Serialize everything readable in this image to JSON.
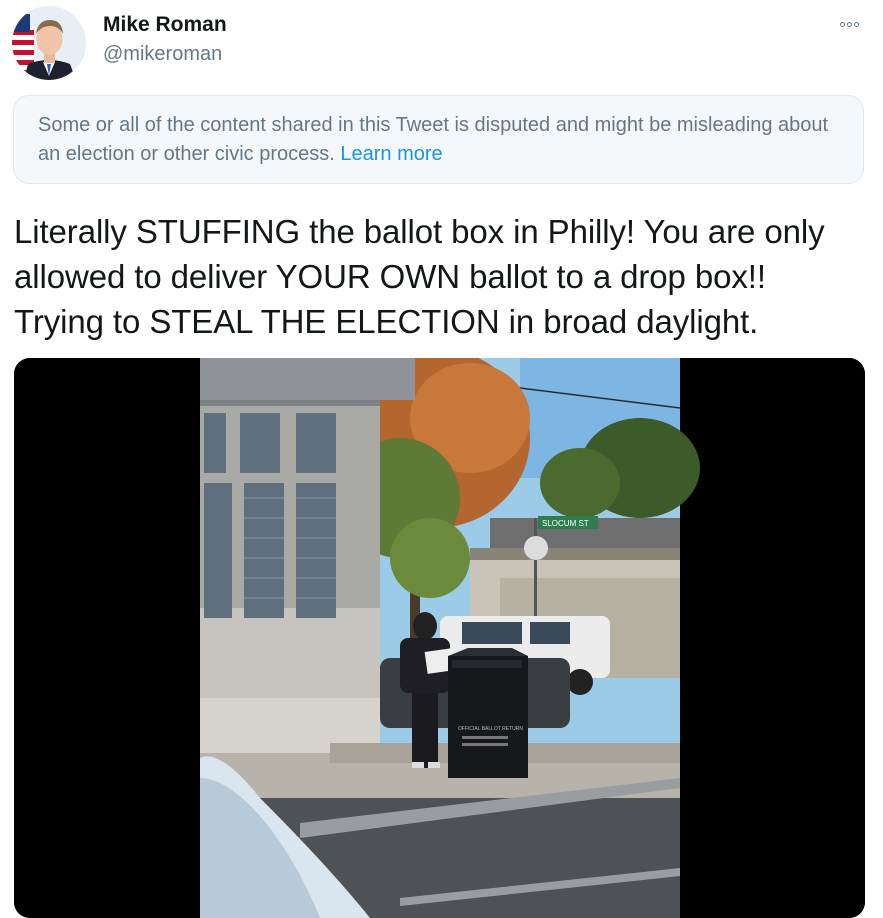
{
  "author": {
    "name": "Mike Roman",
    "handle": "@mikeroman"
  },
  "icons": {
    "more": "more-options-icon",
    "avatar": "avatar"
  },
  "notice": {
    "text": "Some or all of the content shared in this Tweet is disputed and might be misleading about an election or other civic process.",
    "link_label": "Learn more"
  },
  "tweet": {
    "lines": [
      "Literally STUFFING the ballot box in Philly!  You are only",
      "allowed to deliver YOUR OWN ballot to a drop box!!",
      "Trying to STEAL THE ELECTION in broad daylight."
    ]
  },
  "media": {
    "street_sign": "SLOCUM ST",
    "dropbox_label": "OFFICIAL BALLOT RETURN"
  },
  "colors": {
    "text_primary": "#14171a",
    "text_secondary": "#657786",
    "link": "#1b95e0",
    "notice_bg": "#f5f8fa",
    "notice_border": "#e1e8ed"
  }
}
